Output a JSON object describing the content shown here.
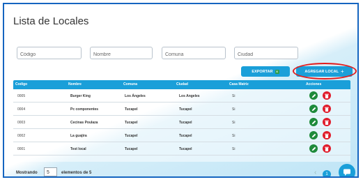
{
  "page": {
    "title": "Lista de Locales"
  },
  "filters": {
    "codigo_placeholder": "Código",
    "nombre_placeholder": "Nombre",
    "comuna_placeholder": "Comuna",
    "ciudad_placeholder": "Ciudad"
  },
  "toolbar": {
    "export_label": "EXPORTAR",
    "add_label": "AGREGAR LOCAL"
  },
  "table": {
    "headers": [
      "Codigo",
      "Nombre",
      "Comuna",
      "Ciudad",
      "Casa Matriz",
      "Acciones"
    ],
    "rows": [
      {
        "codigo": "0005",
        "nombre": "Burger King",
        "comuna": "Los Ángeles",
        "ciudad": "Los Angeles",
        "casa_matriz": "Si"
      },
      {
        "codigo": "0004",
        "nombre": "Pc componentes",
        "comuna": "Tucapel",
        "ciudad": "Tucapel",
        "casa_matriz": "Si"
      },
      {
        "codigo": "0003",
        "nombre": "Cecinas Poulaza",
        "comuna": "Tucapel",
        "ciudad": "Tucapel",
        "casa_matriz": "Si"
      },
      {
        "codigo": "0002",
        "nombre": "La guajira",
        "comuna": "Tucapel",
        "ciudad": "Tucapel",
        "casa_matriz": "Si"
      },
      {
        "codigo": "0001",
        "nombre": "Test local",
        "comuna": "Tucapel",
        "ciudad": "Tucapel",
        "casa_matriz": "Si"
      }
    ]
  },
  "footer": {
    "showing_label": "Mostrando",
    "page_size": "5",
    "elements_label": "elementos de 5",
    "current_page": "1"
  },
  "colors": {
    "accent": "#1a9fd9",
    "edit": "#1e8a3a",
    "delete": "#e01c2b",
    "highlight": "#e31b1b",
    "frame_border": "#1565c0"
  },
  "icons": {
    "export": "excel-icon",
    "add": "plus-icon",
    "edit": "pencil-icon",
    "delete": "trash-icon",
    "chat": "chat-bubble-icon",
    "prev": "chevron-left-icon"
  }
}
